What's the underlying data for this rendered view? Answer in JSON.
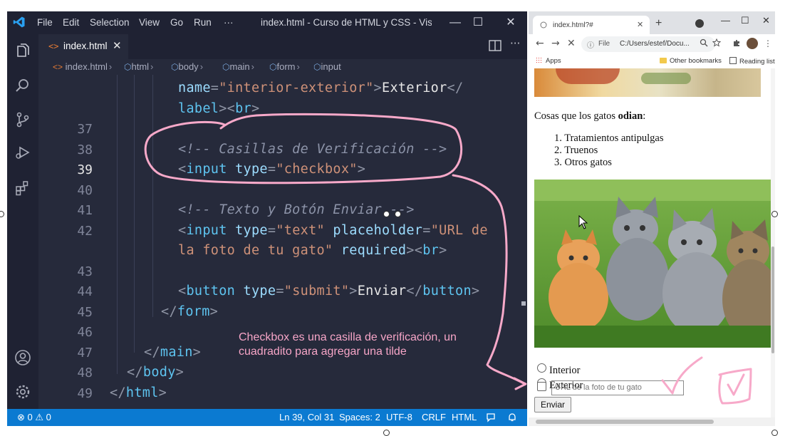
{
  "vscode": {
    "menu": [
      "File",
      "Edit",
      "Selection",
      "View",
      "Go",
      "Run",
      "···"
    ],
    "window_title": "index.html - Curso de HTML y CSS - Visua...",
    "window_controls": {
      "minimize": "—",
      "maximize": "☐",
      "close": "✕"
    },
    "tab": {
      "icon": "<>",
      "label": "index.html",
      "close": "✕"
    },
    "more_actions": "···",
    "breadcrumb": [
      "index.html",
      "html",
      "body",
      "main",
      "form",
      "input"
    ],
    "lines": [
      {
        "num": "",
        "tokens": [
          {
            "t": "attr",
            "v": "name"
          },
          {
            "t": "punct",
            "v": "="
          },
          {
            "t": "str",
            "v": "\"interior-exterior\""
          },
          {
            "t": "punct",
            "v": ">"
          },
          {
            "t": "text",
            "v": "Exterior"
          },
          {
            "t": "punct",
            "v": "</"
          }
        ]
      },
      {
        "num": "",
        "tokens": [
          {
            "t": "tag",
            "v": "label"
          },
          {
            "t": "punct",
            "v": ">"
          },
          {
            "t": "punct",
            "v": "<"
          },
          {
            "t": "tag",
            "v": "br"
          },
          {
            "t": "punct",
            "v": ">"
          }
        ]
      },
      {
        "num": "37",
        "tokens": []
      },
      {
        "num": "38",
        "tokens": [
          {
            "t": "comment",
            "v": "<!-- Casillas de Verificación -->"
          }
        ]
      },
      {
        "num": "39",
        "tokens": [
          {
            "t": "punct",
            "v": "<"
          },
          {
            "t": "tag",
            "v": "input"
          },
          {
            "t": "text",
            "v": " "
          },
          {
            "t": "attr",
            "v": "type"
          },
          {
            "t": "punct",
            "v": "="
          },
          {
            "t": "str",
            "v": "\"checkbox\""
          },
          {
            "t": "punct",
            "v": ">"
          }
        ]
      },
      {
        "num": "40",
        "tokens": []
      },
      {
        "num": "41",
        "tokens": [
          {
            "t": "comment",
            "v": "<!-- Texto y Botón Enviar -->"
          }
        ]
      },
      {
        "num": "42",
        "tokens": [
          {
            "t": "punct",
            "v": "<"
          },
          {
            "t": "tag",
            "v": "input"
          },
          {
            "t": "text",
            "v": " "
          },
          {
            "t": "attr",
            "v": "type"
          },
          {
            "t": "punct",
            "v": "="
          },
          {
            "t": "str",
            "v": "\"text\""
          },
          {
            "t": "text",
            "v": " "
          },
          {
            "t": "attr",
            "v": "placeholder"
          },
          {
            "t": "punct",
            "v": "="
          },
          {
            "t": "str",
            "v": "\"URL de"
          }
        ]
      },
      {
        "num": "",
        "tokens": [
          {
            "t": "str",
            "v": "la foto de tu gato\""
          },
          {
            "t": "text",
            "v": " "
          },
          {
            "t": "attr",
            "v": "required"
          },
          {
            "t": "punct",
            "v": ">"
          },
          {
            "t": "punct",
            "v": "<"
          },
          {
            "t": "tag",
            "v": "br"
          },
          {
            "t": "punct",
            "v": ">"
          }
        ]
      },
      {
        "num": "43",
        "tokens": []
      },
      {
        "num": "44",
        "tokens": [
          {
            "t": "punct",
            "v": "<"
          },
          {
            "t": "tag",
            "v": "button"
          },
          {
            "t": "text",
            "v": " "
          },
          {
            "t": "attr",
            "v": "type"
          },
          {
            "t": "punct",
            "v": "="
          },
          {
            "t": "str",
            "v": "\"submit\""
          },
          {
            "t": "punct",
            "v": ">"
          },
          {
            "t": "text",
            "v": "Enviar"
          },
          {
            "t": "punct",
            "v": "</"
          },
          {
            "t": "tag",
            "v": "button"
          },
          {
            "t": "punct",
            "v": ">"
          }
        ]
      },
      {
        "num": "45",
        "tokens": [
          {
            "t": "punct",
            "v": "</"
          },
          {
            "t": "tag",
            "v": "form"
          },
          {
            "t": "punct",
            "v": ">"
          }
        ]
      },
      {
        "num": "46",
        "tokens": []
      },
      {
        "num": "47",
        "tokens": [
          {
            "t": "punct",
            "v": "</"
          },
          {
            "t": "tag",
            "v": "main"
          },
          {
            "t": "punct",
            "v": ">"
          }
        ]
      },
      {
        "num": "48",
        "tokens": [
          {
            "t": "punct",
            "v": "</"
          },
          {
            "t": "tag",
            "v": "body"
          },
          {
            "t": "punct",
            "v": ">"
          }
        ]
      },
      {
        "num": "49",
        "tokens": [
          {
            "t": "punct",
            "v": "</"
          },
          {
            "t": "tag",
            "v": "html"
          },
          {
            "t": "punct",
            "v": ">"
          }
        ]
      }
    ],
    "active_line": "39",
    "status": {
      "problems": "⊗ 0 ⚠ 0",
      "position": "Ln 39, Col 31",
      "spaces": "Spaces: 2",
      "encoding": "UTF-8",
      "eol": "CRLF",
      "language": "HTML"
    },
    "colors": {
      "accent_status": "#0b7ad1",
      "editor_bg": "#262a3b",
      "chrome_bg": "#1f2233"
    }
  },
  "browser": {
    "tab_title": "index.html?#",
    "tab_close": "✕",
    "new_tab": "+",
    "window_controls": {
      "minimize": "—",
      "maximize": "☐",
      "close": "✕"
    },
    "nav": {
      "back": "←",
      "forward": "→",
      "stop": "✕"
    },
    "omnibox": {
      "info": "ⓘ",
      "scheme": "File",
      "url": "C:/Users/estef/Docu..."
    },
    "bookmarks": {
      "apps": "Apps",
      "other": "Other bookmarks",
      "reading": "Reading list"
    },
    "page": {
      "hate_prefix": "Cosas que los gatos ",
      "hate_bold": "odian",
      "hate_suffix": ":",
      "hate_list": [
        "Tratamientos antipulgas",
        "Truenos",
        "Otros gatos"
      ],
      "radio_interior": "Interior",
      "radio_exterior": "Exterior",
      "text_placeholder": "URL de la foto de tu gato",
      "submit_label": "Enviar"
    }
  },
  "annotation": {
    "note": "Checkbox es una casilla de verificación, un cuadradito para agregar una tilde",
    "color": "#f6a5c7"
  }
}
